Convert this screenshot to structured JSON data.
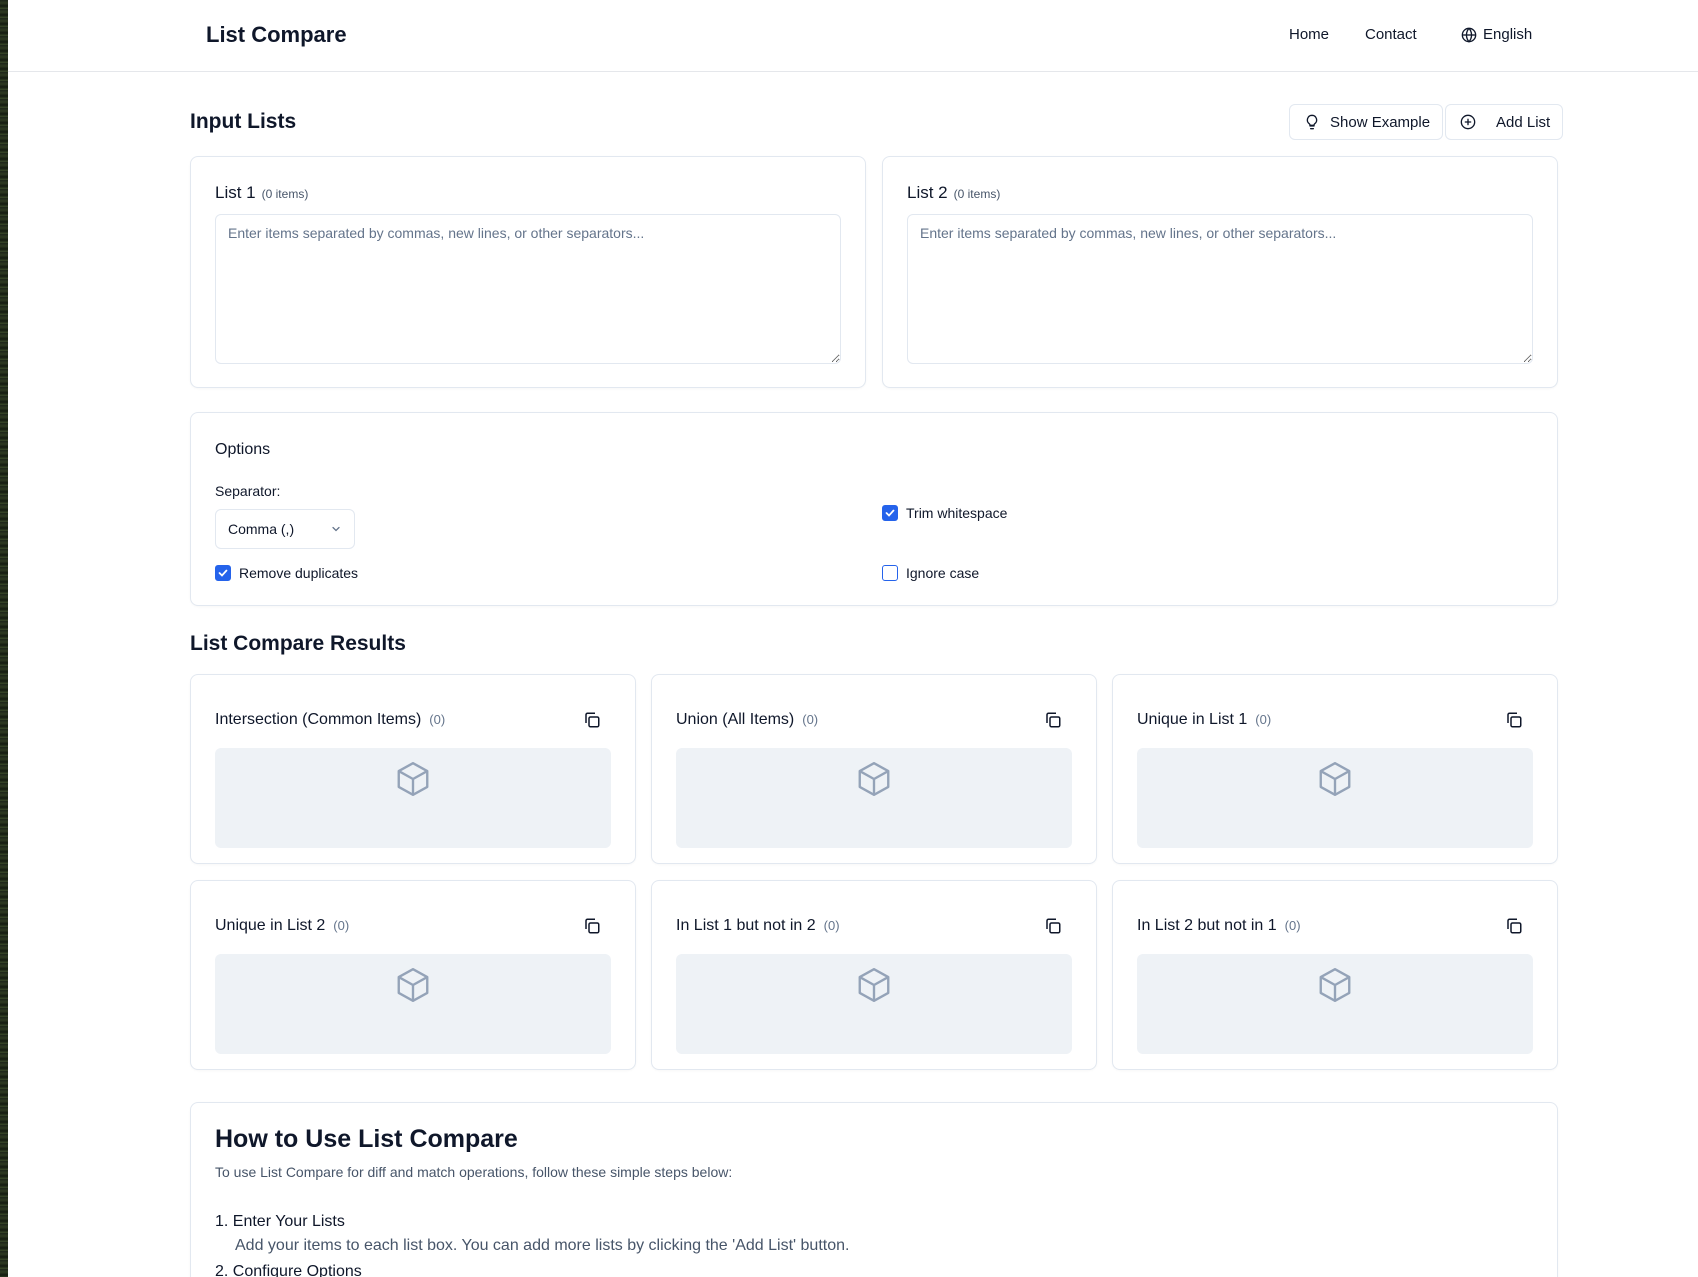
{
  "header": {
    "logo": "List Compare",
    "nav": {
      "home": "Home",
      "contact": "Contact",
      "language": "English"
    }
  },
  "input_section": {
    "title": "Input Lists",
    "show_example_label": "Show Example",
    "add_list_label": "Add List",
    "lists": [
      {
        "label": "List 1",
        "count": "(0 items)",
        "placeholder": "Enter items separated by commas, new lines, or other separators...",
        "value": ""
      },
      {
        "label": "List 2",
        "count": "(0 items)",
        "placeholder": "Enter items separated by commas, new lines, or other separators...",
        "value": ""
      }
    ]
  },
  "options": {
    "title": "Options",
    "separator_label": "Separator:",
    "separator_value": "Comma (,)",
    "trim_whitespace": {
      "label": "Trim whitespace",
      "checked": true
    },
    "remove_duplicates": {
      "label": "Remove duplicates",
      "checked": true
    },
    "ignore_case": {
      "label": "Ignore case",
      "checked": false
    }
  },
  "results": {
    "title": "List Compare Results",
    "cards": [
      {
        "title": "Intersection (Common Items)",
        "count": "(0)"
      },
      {
        "title": "Union (All Items)",
        "count": "(0)"
      },
      {
        "title": "Unique in List 1",
        "count": "(0)"
      },
      {
        "title": "Unique in List 2",
        "count": "(0)"
      },
      {
        "title": "In List 1 but not in 2",
        "count": "(0)"
      },
      {
        "title": "In List 2 but not in 1",
        "count": "(0)"
      }
    ]
  },
  "how_to": {
    "title": "How to Use List Compare",
    "subtitle": "To use List Compare for diff and match operations, follow these simple steps below:",
    "steps": [
      {
        "title": "1. Enter Your Lists",
        "desc": "Add your items to each list box. You can add more lists by clicking the 'Add List' button."
      },
      {
        "title": "2. Configure Options",
        "desc": ""
      }
    ]
  },
  "colors": {
    "accent": "#2563eb",
    "border": "#e2e8f0",
    "empty_bg": "#eef2f6"
  }
}
